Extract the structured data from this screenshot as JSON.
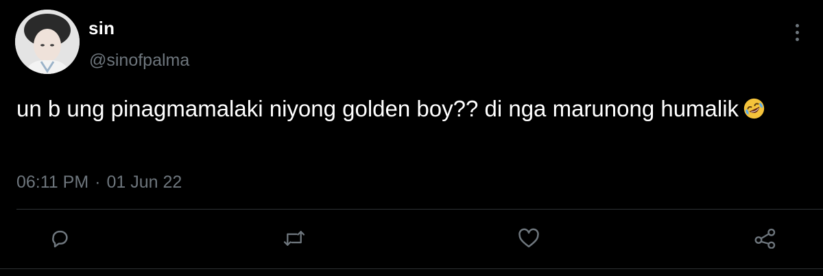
{
  "author": {
    "name": "sin",
    "handle": "@sinofpalma"
  },
  "tweet": {
    "text": "un b ung pinagmamalaki niyong golden boy?? di nga marunong humalik",
    "emoji": "rolling-on-the-floor-laughing"
  },
  "meta": {
    "time": "06:11 PM",
    "separator": "·",
    "date": "01 Jun 22"
  },
  "actions": {
    "reply_icon": "reply-icon",
    "retweet_icon": "retweet-icon",
    "like_icon": "like-icon",
    "share_icon": "share-icon"
  },
  "colors": {
    "background": "#000000",
    "text": "#ffffff",
    "muted": "#6e767d",
    "divider": "#2f3336"
  }
}
